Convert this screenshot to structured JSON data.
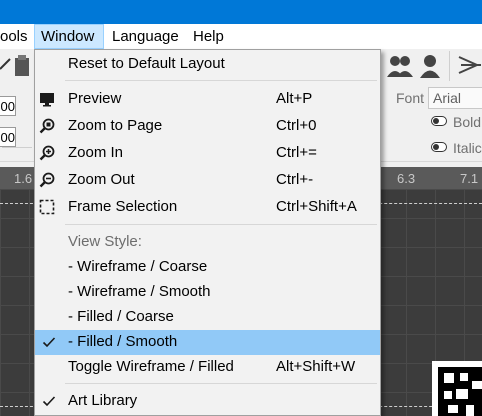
{
  "menubar": {
    "tools": "ools",
    "window": "Window",
    "language": "Language",
    "help": "Help"
  },
  "toolbar": {
    "num1": "00",
    "num2": "00",
    "font_label": "Font",
    "font_value": "Arial",
    "bold": "Bold",
    "italic": "Italic"
  },
  "ruler": {
    "left": "1.6",
    "mid": "6.3",
    "right": "7.1"
  },
  "menu": {
    "reset": {
      "label": "Reset to Default Layout"
    },
    "preview": {
      "label": "Preview",
      "shortcut": "Alt+P",
      "icon": "monitor-icon"
    },
    "zoom_page": {
      "label": "Zoom to Page",
      "shortcut": "Ctrl+0",
      "icon": "zoom-page-icon"
    },
    "zoom_in": {
      "label": "Zoom In",
      "shortcut": "Ctrl+=",
      "icon": "zoom-in-icon"
    },
    "zoom_out": {
      "label": "Zoom Out",
      "shortcut": "Ctrl+-",
      "icon": "zoom-out-icon"
    },
    "frame_sel": {
      "label": "Frame Selection",
      "shortcut": "Ctrl+Shift+A",
      "icon": "frame-selection-icon"
    },
    "view_style": {
      "label": "View Style:"
    },
    "wire_coarse": {
      "label": "-  Wireframe / Coarse"
    },
    "wire_smooth": {
      "label": "-  Wireframe / Smooth"
    },
    "filled_coarse": {
      "label": "-  Filled / Coarse"
    },
    "filled_smooth": {
      "label": "-  Filled / Smooth",
      "checked": true
    },
    "toggle": {
      "label": "Toggle Wireframe / Filled",
      "shortcut": "Alt+Shift+W"
    },
    "art_library": {
      "label": "Art Library",
      "checked": true
    }
  },
  "colors": {
    "titlebar": "#0078d7",
    "menu_highlight": "#91c9f7",
    "menubar_active": "#cce8ff",
    "canvas": "#3c3c3c"
  }
}
